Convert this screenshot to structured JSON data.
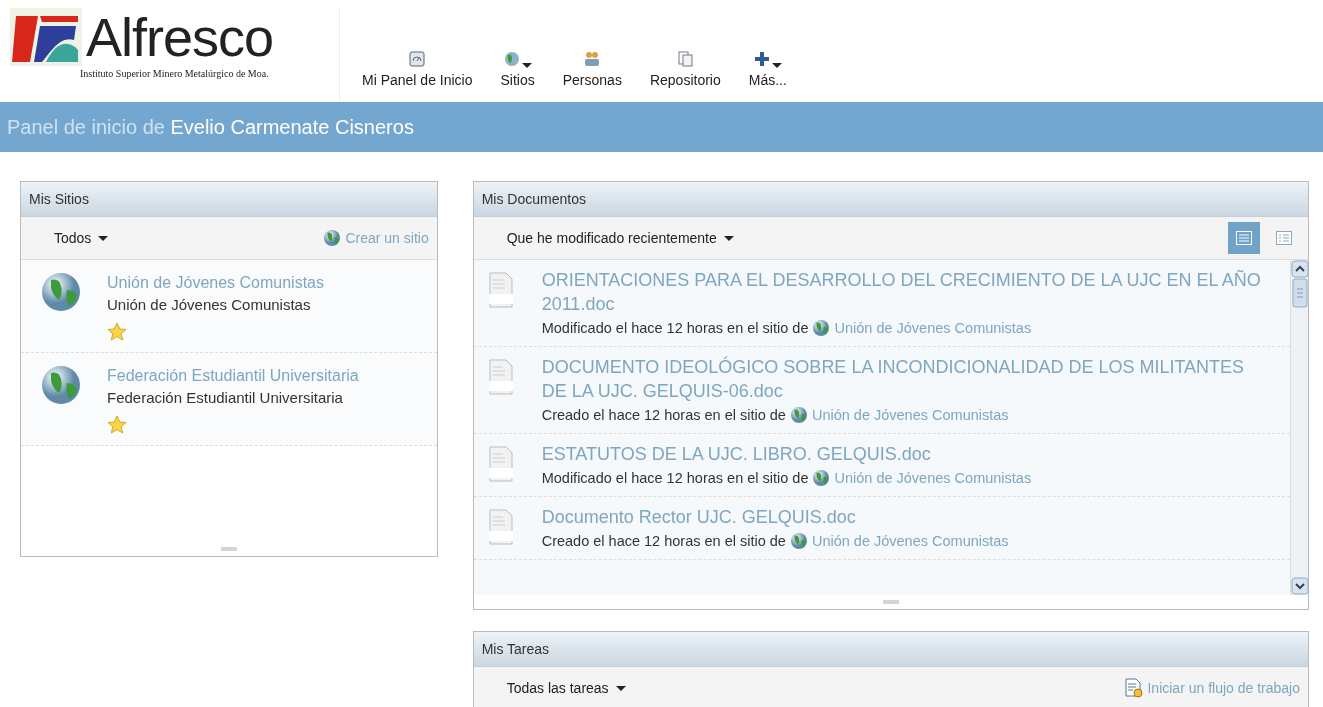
{
  "header": {
    "logo_text": "Alfresco",
    "institution": "Instituto Superior Minero Metalúrgico de Moa."
  },
  "nav": [
    {
      "label": "Mi Panel de Inicio",
      "kind": "dashboard",
      "dropdown": false
    },
    {
      "label": "Sitios",
      "kind": "globe",
      "dropdown": true
    },
    {
      "label": "Personas",
      "kind": "people",
      "dropdown": false
    },
    {
      "label": "Repositorio",
      "kind": "repository",
      "dropdown": false
    },
    {
      "label": "Más...",
      "kind": "plus",
      "dropdown": true
    }
  ],
  "title_bar": {
    "prefix": "Panel de inicio de",
    "user": "Evelio Carmenate Cisneros"
  },
  "my_sites": {
    "title": "Mis Sitios",
    "filter": "Todos",
    "action": "Crear un sitio",
    "sites": [
      {
        "name": "Unión de Jóvenes Comunistas",
        "description": "Unión de Jóvenes Comunistas",
        "favorite": true
      },
      {
        "name": "Federación Estudiantil Universitaria",
        "description": "Federación Estudiantil Universitaria",
        "favorite": true
      }
    ]
  },
  "my_documents": {
    "title": "Mis Documentos",
    "filter": "Que he modificado recientemente",
    "views": [
      {
        "kind": "detailed",
        "selected": true
      },
      {
        "kind": "simple",
        "selected": false
      }
    ],
    "documents": [
      {
        "name": "ORIENTACIONES PARA EL DESARROLLO DEL CRECIMIENTO DE LA UJC EN EL AÑO 2011.doc",
        "action": "Modificado el hace 12 horas en el sitio de",
        "site": "Unión de Jóvenes Comunistas"
      },
      {
        "name": "DOCUMENTO IDEOLÓGICO SOBRE LA INCONDICIONALIDAD DE LOS MILITANTES DE LA UJC. GELQUIS-06.doc",
        "action": "Creado el hace 12 horas en el sitio de",
        "site": "Unión de Jóvenes Comunistas"
      },
      {
        "name": "ESTATUTOS DE LA UJC. LIBRO. GELQUIS.doc",
        "action": "Modificado el hace 12 horas en el sitio de",
        "site": "Unión de Jóvenes Comunistas"
      },
      {
        "name": "Documento Rector UJC. GELQUIS.doc",
        "action": "Creado el hace 12 horas en el sitio de",
        "site": "Unión de Jóvenes Comunistas"
      }
    ]
  },
  "my_tasks": {
    "title": "Mis Tareas",
    "filter": "Todas las tareas",
    "action": "Iniciar un flujo de trabajo"
  }
}
